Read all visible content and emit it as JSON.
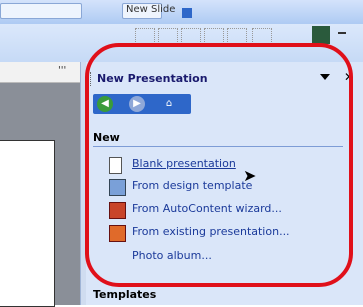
{
  "toolbar": {
    "new_slide_label": "New Slide"
  },
  "pane": {
    "title": "New Presentation",
    "section_new": "New",
    "items": [
      {
        "label": "Blank presentation",
        "icon": "blank-doc-icon"
      },
      {
        "label": "From design template",
        "icon": "design-template-icon"
      },
      {
        "label": "From AutoContent wizard...",
        "icon": "wizard-icon"
      },
      {
        "label": "From existing presentation...",
        "icon": "existing-presentation-icon"
      },
      {
        "label": "Photo album...",
        "icon": ""
      }
    ],
    "section_templates": "Templates"
  },
  "ruler": {
    "marks": "'''"
  },
  "colors": {
    "highlight": "#e0101a",
    "pane_bg": "#dae6f9",
    "nav_bg": "#2e67c9",
    "link": "#1b3a9a"
  }
}
